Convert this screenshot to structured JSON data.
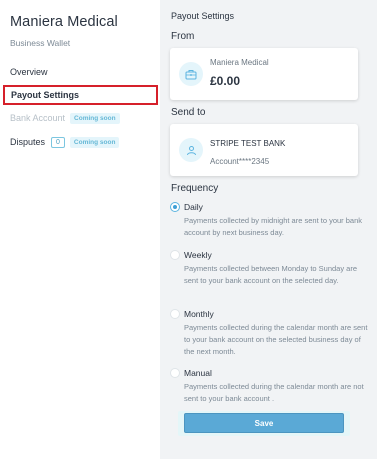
{
  "brand": {
    "title": "Maniera Medical",
    "subtitle": "Business Wallet"
  },
  "sidebar": {
    "items": [
      {
        "label": "Overview"
      },
      {
        "label": "Payout Settings"
      },
      {
        "label": "Bank Account",
        "badge": "Coming soon"
      },
      {
        "label": "Disputes",
        "count": "0",
        "badge": "Coming soon"
      }
    ]
  },
  "main": {
    "title": "Payout Settings",
    "from_label": "From",
    "from_card": {
      "name": "Maniera Medical",
      "amount": "£0.00",
      "icon": "wallet-icon"
    },
    "sendto_label": "Send to",
    "sendto_card": {
      "name": "STRIPE TEST BANK",
      "account": "Account****2345",
      "icon": "bank-person-icon"
    },
    "frequency_label": "Frequency",
    "frequency_options": [
      {
        "title": "Daily",
        "desc": "Payments collected by midnight are sent to your bank account by next business day.",
        "selected": true
      },
      {
        "title": "Weekly",
        "desc": "Payments collected between Monday to Sunday are sent to your bank account on the selected day.",
        "selected": false
      },
      {
        "title": "Monthly",
        "desc": "Payments collected during the calendar month are sent to your bank account on the selected business day of the next month.",
        "selected": false
      },
      {
        "title": "Manual",
        "desc": "Payments collected during the calendar month are not sent to your bank account .",
        "selected": false
      }
    ],
    "save_label": "Save"
  },
  "colors": {
    "accent": "#3f9fd6",
    "highlight_border": "#d6202a",
    "badge_bg": "#e4f5fb",
    "main_bg": "#f1f3f5"
  }
}
